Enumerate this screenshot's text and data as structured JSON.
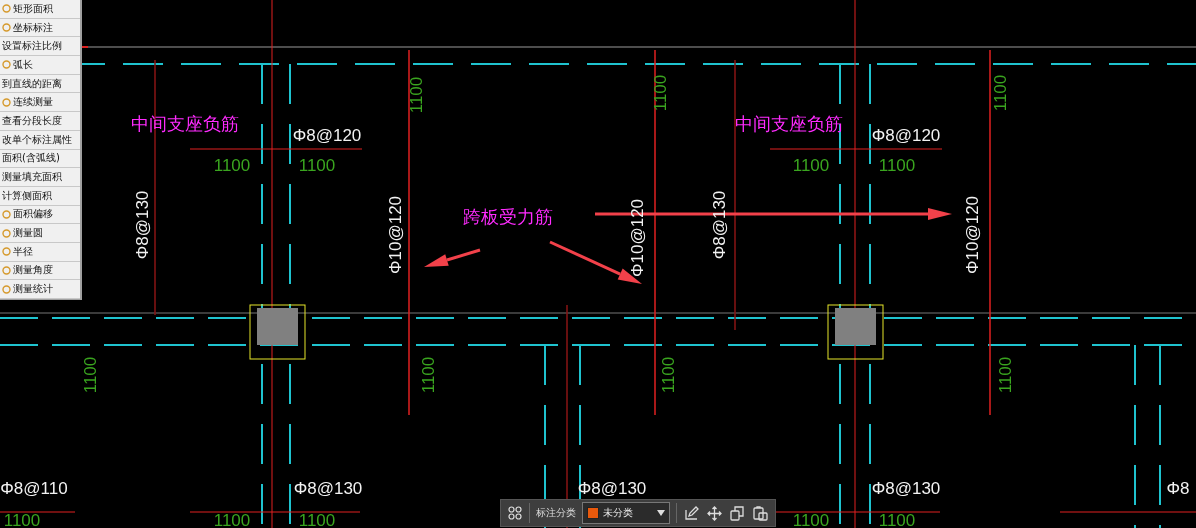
{
  "tool_menu": {
    "items": [
      {
        "label": "矩形面积",
        "has_icon": true
      },
      {
        "label": "坐标标注",
        "has_icon": true
      },
      {
        "label": "设置标注比例",
        "has_icon": false
      },
      {
        "label": "弧长",
        "has_icon": true
      },
      {
        "label": "到直线的距离",
        "has_icon": false
      },
      {
        "label": "连续测量",
        "has_icon": true
      },
      {
        "label": "查看分段长度",
        "has_icon": false
      },
      {
        "label": "改单个标注属性",
        "has_icon": false
      },
      {
        "label": "面积(含弧线)",
        "has_icon": false
      },
      {
        "label": "测量填充面积",
        "has_icon": false
      },
      {
        "label": "计算侧面积",
        "has_icon": false
      },
      {
        "label": "面积偏移",
        "has_icon": true
      },
      {
        "label": "测量圆",
        "has_icon": true
      },
      {
        "label": "半径",
        "has_icon": true
      },
      {
        "label": "测量角度",
        "has_icon": true
      },
      {
        "label": "测量统计",
        "has_icon": true
      }
    ]
  },
  "annotations": [
    {
      "kind": "label",
      "text": "中间支座负筋",
      "vertical": false
    },
    {
      "kind": "rebar",
      "text": "Φ8@120",
      "vertical": false
    },
    {
      "kind": "dimension",
      "text": "1100",
      "vertical": false
    },
    {
      "kind": "dimension",
      "text": "1100",
      "vertical": false
    },
    {
      "kind": "dimension",
      "text": "1100",
      "vertical": true
    },
    {
      "kind": "rebar",
      "text": "Φ8@130",
      "vertical": true
    },
    {
      "kind": "rebar",
      "text": "Φ10@120",
      "vertical": true
    },
    {
      "kind": "label",
      "text": "跨板受力筋",
      "vertical": false
    },
    {
      "kind": "label",
      "text": "中间支座负筋",
      "vertical": false
    },
    {
      "kind": "rebar",
      "text": "Φ8@120",
      "vertical": false
    },
    {
      "kind": "dimension",
      "text": "1100",
      "vertical": false
    },
    {
      "kind": "dimension",
      "text": "1100",
      "vertical": false
    },
    {
      "kind": "dimension",
      "text": "1100",
      "vertical": true
    },
    {
      "kind": "dimension",
      "text": "1100",
      "vertical": true
    },
    {
      "kind": "rebar",
      "text": "Φ10@120",
      "vertical": true
    },
    {
      "kind": "rebar",
      "text": "Φ8@130",
      "vertical": true
    },
    {
      "kind": "rebar",
      "text": "Φ10@120",
      "vertical": true
    },
    {
      "kind": "dimension",
      "text": "1100",
      "vertical": true
    },
    {
      "kind": "dimension",
      "text": "1100",
      "vertical": true
    },
    {
      "kind": "dimension",
      "text": "1100",
      "vertical": true
    },
    {
      "kind": "dimension",
      "text": "1100",
      "vertical": true
    },
    {
      "kind": "rebar",
      "text": "Φ8@110",
      "vertical": false
    },
    {
      "kind": "rebar",
      "text": "Φ8@130",
      "vertical": false
    },
    {
      "kind": "rebar",
      "text": "Φ8@130",
      "vertical": false
    },
    {
      "kind": "rebar",
      "text": "Φ8@130",
      "vertical": false
    },
    {
      "kind": "rebar",
      "text": "Φ8",
      "vertical": false
    },
    {
      "kind": "dimension",
      "text": "1100",
      "vertical": false
    },
    {
      "kind": "dimension",
      "text": "1100",
      "vertical": false
    },
    {
      "kind": "dimension",
      "text": "1100",
      "vertical": false
    },
    {
      "kind": "dimension",
      "text": "1100",
      "vertical": false
    },
    {
      "kind": "dimension",
      "text": "1100",
      "vertical": false
    }
  ],
  "toolbar": {
    "category_label": "标注分类",
    "category": {
      "value": "未分类",
      "color": "#e8590c"
    }
  }
}
